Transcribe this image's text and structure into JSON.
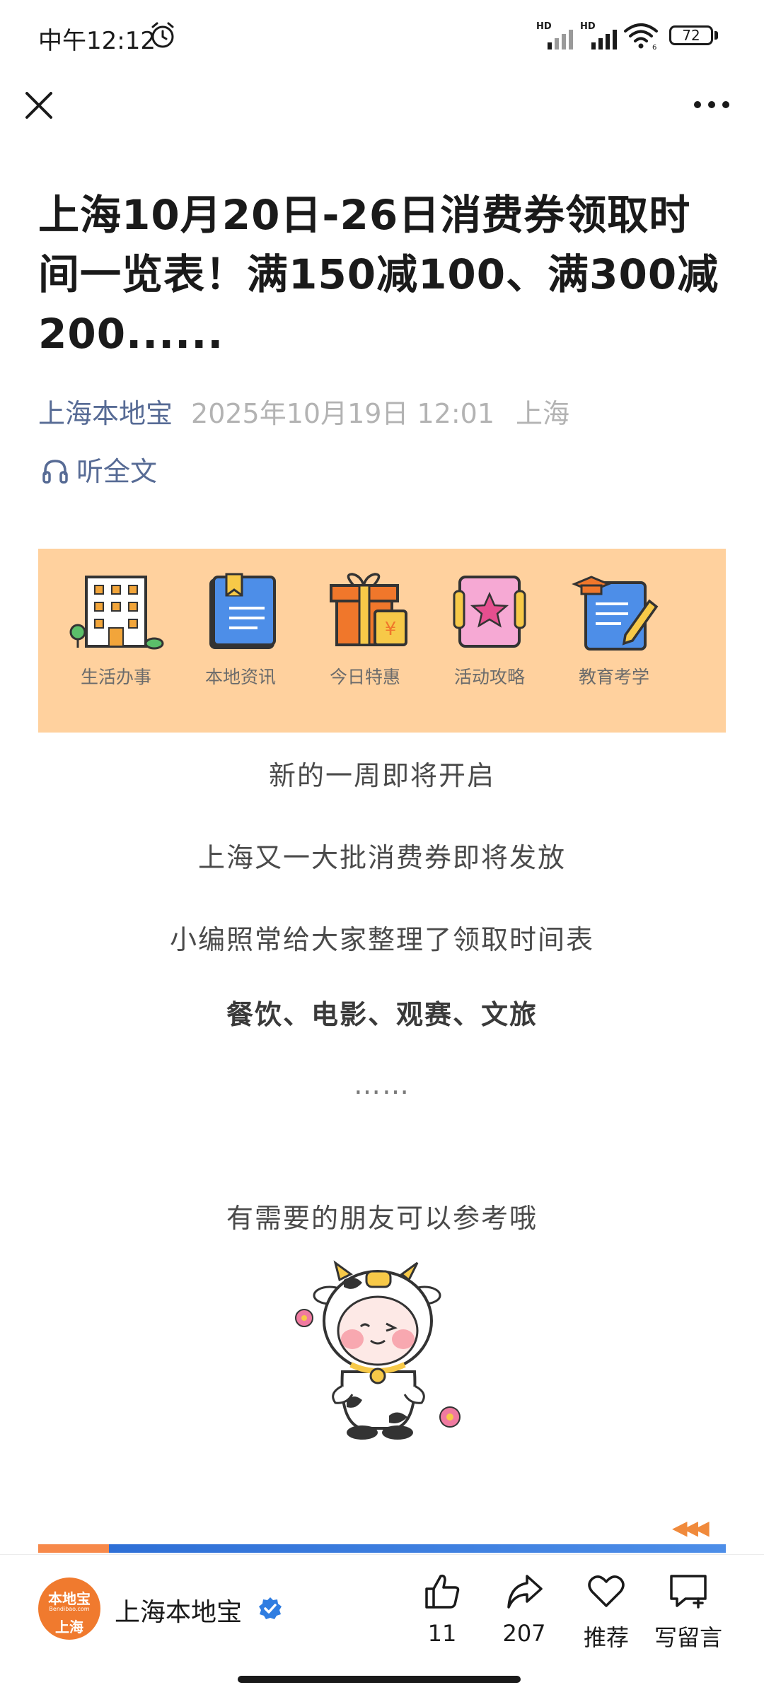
{
  "status_bar": {
    "time": "中午12:12",
    "sim1_label": "HD",
    "sim2_label": "HD",
    "battery_percent": "72",
    "battery_level": 0.72
  },
  "nav": {
    "close_icon": "close-icon",
    "more_icon": "more-icon"
  },
  "article": {
    "title": "上海10月20日-26日消费券领取时间一览表！满150减100、满300减200......",
    "author": "上海本地宝",
    "date": "2025年10月19日 12:01",
    "location": "上海",
    "listen_label": "听全文"
  },
  "banner": {
    "items": [
      {
        "label": "生活办事",
        "icon": "building-icon"
      },
      {
        "label": "本地资讯",
        "icon": "notebook-icon"
      },
      {
        "label": "今日特惠",
        "icon": "gift-icon"
      },
      {
        "label": "活动攻略",
        "icon": "star-book-icon"
      },
      {
        "label": "教育考学",
        "icon": "graduation-icon"
      }
    ]
  },
  "body": {
    "p1": "新的一周即将开启",
    "p2": "上海又一大批消费券即将发放",
    "p3": "小编照常给大家整理了领取时间表",
    "p4": "餐饮、电影、观赛、文旅",
    "p5": "……",
    "p6": "有需要的朋友可以参考哦"
  },
  "bottom_bar": {
    "account_name": "上海本地宝",
    "avatar_text_top": "本地宝",
    "avatar_text_mid": "Bendibao.com",
    "avatar_text_bottom": "上海",
    "like_count": "11",
    "share_count": "207",
    "recommend_label": "推荐",
    "comment_label": "写留言"
  }
}
